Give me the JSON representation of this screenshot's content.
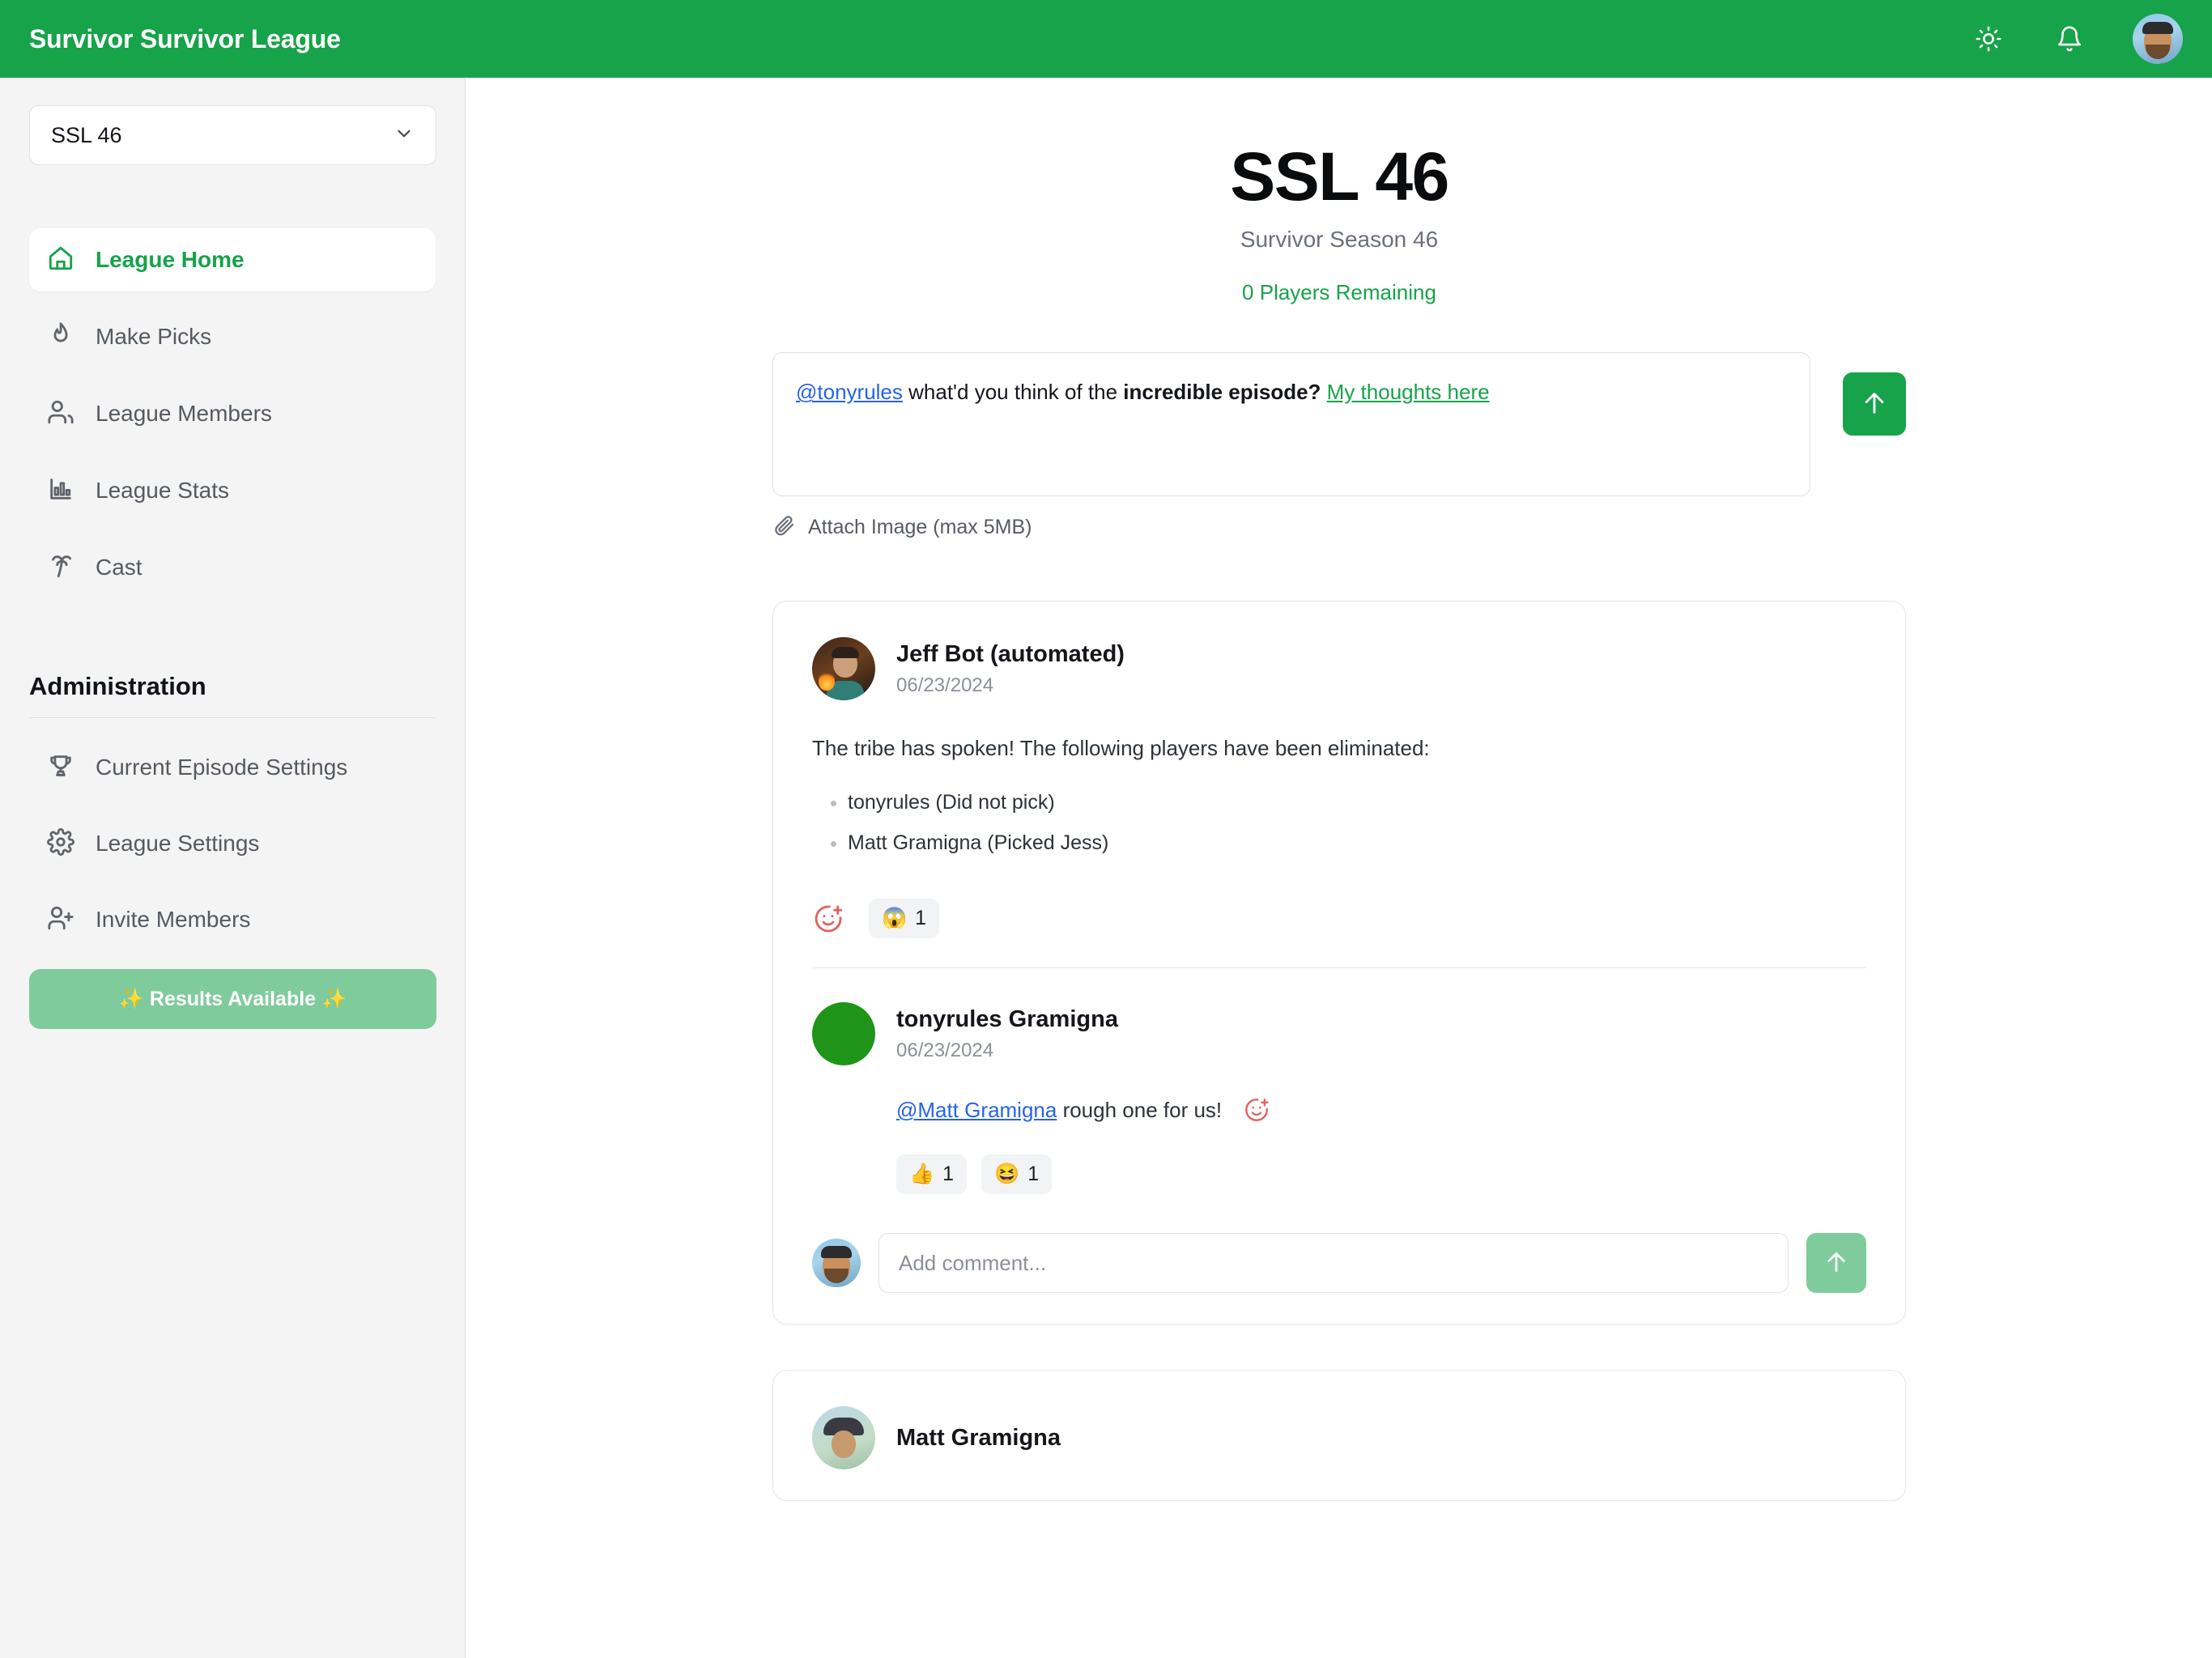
{
  "topbar": {
    "brand": "Survivor Survivor League",
    "theme_toggle_icon": "sun-icon",
    "notifications_icon": "bell-icon",
    "avatar_icon": "user-avatar"
  },
  "sidebar": {
    "league_selector": {
      "value": "SSL 46",
      "chevron_icon": "chevron-down-icon"
    },
    "nav": [
      {
        "label": "League Home",
        "icon": "home-icon",
        "active": true
      },
      {
        "label": "Make Picks",
        "icon": "flame-icon",
        "active": false
      },
      {
        "label": "League Members",
        "icon": "users-icon",
        "active": false
      },
      {
        "label": "League Stats",
        "icon": "bar-chart-icon",
        "active": false
      },
      {
        "label": "Cast",
        "icon": "palm-tree-icon",
        "active": false
      }
    ],
    "admin_heading": "Administration",
    "admin_nav": [
      {
        "label": "Current Episode Settings",
        "icon": "trophy-icon"
      },
      {
        "label": "League Settings",
        "icon": "gear-icon"
      },
      {
        "label": "Invite Members",
        "icon": "user-plus-icon"
      }
    ],
    "results_button": "✨ Results Available ✨"
  },
  "main": {
    "title": "SSL 46",
    "subtitle": "Survivor Season 46",
    "players_remaining": "0 Players Remaining",
    "composer": {
      "mention": "@tonyrules",
      "text_before_bold": " what'd you think of the ",
      "bold_text": "incredible episode?",
      "link_text": "My thoughts here",
      "send_icon": "arrow-up-icon",
      "attach_label": "Attach Image (max 5MB)",
      "attach_icon": "paperclip-icon"
    },
    "posts": [
      {
        "author": "Jeff Bot (automated)",
        "date": "06/23/2024",
        "avatar_icon": "jeff-avatar",
        "body": "The tribe has spoken! The following players have been eliminated:",
        "eliminated": [
          "tonyrules  (Did not pick)",
          "Matt Gramigna (Picked Jess)"
        ],
        "add_reaction_icon": "add-reaction-icon",
        "reactions": [
          {
            "emoji": "😱",
            "count": "1"
          }
        ],
        "comments": [
          {
            "author": "tonyrules Gramigna",
            "date": "06/23/2024",
            "avatar_icon": "green-avatar",
            "mention": "@Matt Gramigna",
            "text": " rough one for us!",
            "add_reaction_icon": "add-reaction-icon",
            "reactions": [
              {
                "emoji": "👍",
                "count": "1"
              },
              {
                "emoji": "😆",
                "count": "1"
              }
            ]
          }
        ],
        "add_comment": {
          "placeholder": "Add comment...",
          "value": "",
          "send_icon": "arrow-up-icon",
          "avatar_icon": "user-avatar"
        }
      },
      {
        "author": "Matt Gramigna",
        "date": "",
        "avatar_icon": "matt-avatar",
        "body": "",
        "eliminated": [],
        "reactions": [],
        "comments": []
      }
    ]
  },
  "colors": {
    "brand_green": "#16a34a",
    "muted_green": "#7fcb9b",
    "sidebar_bg": "#f4f4f4",
    "mention_blue": "#2563eb",
    "text_dark": "#14161a",
    "text_muted": "#8b9099"
  }
}
